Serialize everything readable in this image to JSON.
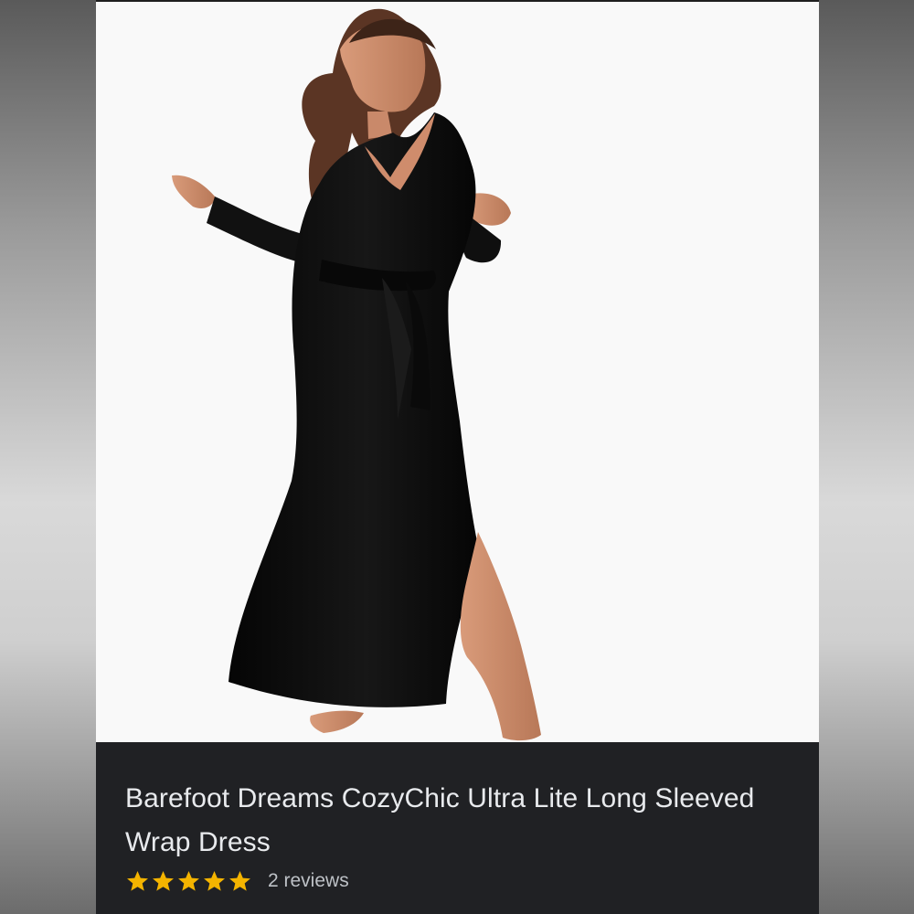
{
  "product": {
    "title": "Barefoot Dreams CozyChic Ultra Lite Long Sleeved Wrap Dress",
    "rating": 5,
    "reviews_text": "2 reviews"
  },
  "icons": {
    "star": "star-icon"
  },
  "colors": {
    "panel_background": "#202124",
    "title_text": "#e8eaed",
    "review_text": "#bdc1c6",
    "star": "#f4b400",
    "dress": "#111111"
  }
}
